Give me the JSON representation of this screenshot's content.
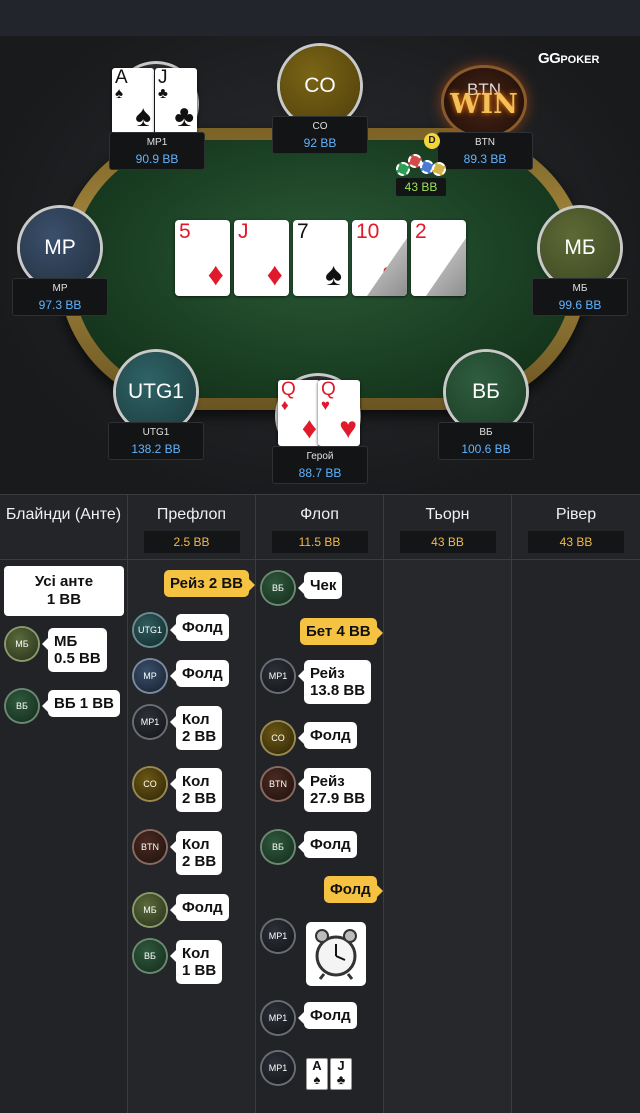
{
  "logo": {
    "main": "GG",
    "sub": "POKER"
  },
  "table": {
    "seats": [
      {
        "id": "mp1",
        "label": "",
        "plate": "MP1",
        "stack": "90.9 BB"
      },
      {
        "id": "co",
        "label": "CO",
        "plate": "CO",
        "stack": "92 BB"
      },
      {
        "id": "btn",
        "label": "BTN",
        "plate": "BTN",
        "stack": "89.3 BB"
      },
      {
        "id": "mp",
        "label": "MP",
        "plate": "MP",
        "stack": "97.3 BB"
      },
      {
        "id": "mb",
        "label": "МБ",
        "plate": "МБ",
        "stack": "99.6 BB"
      },
      {
        "id": "utg1",
        "label": "UTG1",
        "plate": "UTG1",
        "stack": "138.2 BB"
      },
      {
        "id": "bb",
        "label": "ВБ",
        "plate": "ВБ",
        "stack": "100.6 BB"
      },
      {
        "id": "hero",
        "label": "",
        "plate": "Герой",
        "stack": "88.7 BB"
      }
    ],
    "win_badge": "WIN",
    "dealer_button": "D",
    "pot": "43 BB",
    "mp1_cards": [
      {
        "rank": "A",
        "suit": "♠"
      },
      {
        "rank": "J",
        "suit": "♣"
      }
    ],
    "hero_cards": [
      {
        "rank": "Q",
        "suit": "♦"
      },
      {
        "rank": "Q",
        "suit": "♥"
      }
    ],
    "board": [
      {
        "rank": "5",
        "suit": "♦",
        "color": "#e0192c"
      },
      {
        "rank": "J",
        "suit": "♦",
        "color": "#e0192c"
      },
      {
        "rank": "7",
        "suit": "♠",
        "color": "#111111"
      },
      {
        "rank": "10",
        "suit": "♥",
        "color": "#e0192c"
      },
      {
        "rank": "2",
        "suit": "♦",
        "color": "#e0192c"
      }
    ]
  },
  "streets": [
    {
      "title": "Блайнди (Анте)",
      "pot": ""
    },
    {
      "title": "Префлоп",
      "pot": "2.5 BB"
    },
    {
      "title": "Флоп",
      "pot": "11.5 BB"
    },
    {
      "title": "Тьорн",
      "pot": "43 BB"
    },
    {
      "title": "Рівер",
      "pot": "43 BB"
    }
  ],
  "blinds": {
    "ante_line1": "Усі анте",
    "ante_line2": "1 BB",
    "actions": [
      {
        "who": "МБ",
        "text1": "МБ",
        "text2": "0.5 BB"
      },
      {
        "who": "ВБ",
        "text1": "ВБ 1 BB",
        "text2": ""
      }
    ]
  },
  "preflop": {
    "hero_action": "Рейз 2 BB",
    "actions": [
      {
        "who": "UTG1",
        "text1": "Фолд",
        "text2": ""
      },
      {
        "who": "MP",
        "text1": "Фолд",
        "text2": ""
      },
      {
        "who": "MP1",
        "text1": "Кол",
        "text2": "2 BB"
      },
      {
        "who": "CO",
        "text1": "Кол",
        "text2": "2 BB"
      },
      {
        "who": "BTN",
        "text1": "Кол",
        "text2": "2 BB"
      },
      {
        "who": "МБ",
        "text1": "Фолд",
        "text2": ""
      },
      {
        "who": "ВБ",
        "text1": "Кол",
        "text2": "1 BB"
      }
    ]
  },
  "flop": {
    "actions": [
      {
        "who": "ВБ",
        "text1": "Чек",
        "text2": ""
      },
      {
        "who": "MP1",
        "text1": "Рейз",
        "text2": "13.8 BB"
      },
      {
        "who": "CO",
        "text1": "Фолд",
        "text2": ""
      },
      {
        "who": "BTN",
        "text1": "Рейз",
        "text2": "27.9 BB"
      },
      {
        "who": "ВБ",
        "text1": "Фолд",
        "text2": ""
      },
      {
        "who": "MP1",
        "text1": "",
        "text2": ""
      },
      {
        "who": "MP1",
        "text1": "Фолд",
        "text2": ""
      },
      {
        "who": "MP1",
        "text1": "",
        "text2": ""
      }
    ],
    "hero_bet": "Бет 4 BB",
    "hero_fold": "Фолд",
    "shown_cards": [
      {
        "rank": "A",
        "suit": "♠"
      },
      {
        "rank": "J",
        "suit": "♣"
      }
    ]
  },
  "colors": {
    "accent": "#f5c242",
    "stack_blue": "#5fb4ff",
    "pot_green": "#9be15a",
    "pot_orange": "#f2b94b"
  }
}
